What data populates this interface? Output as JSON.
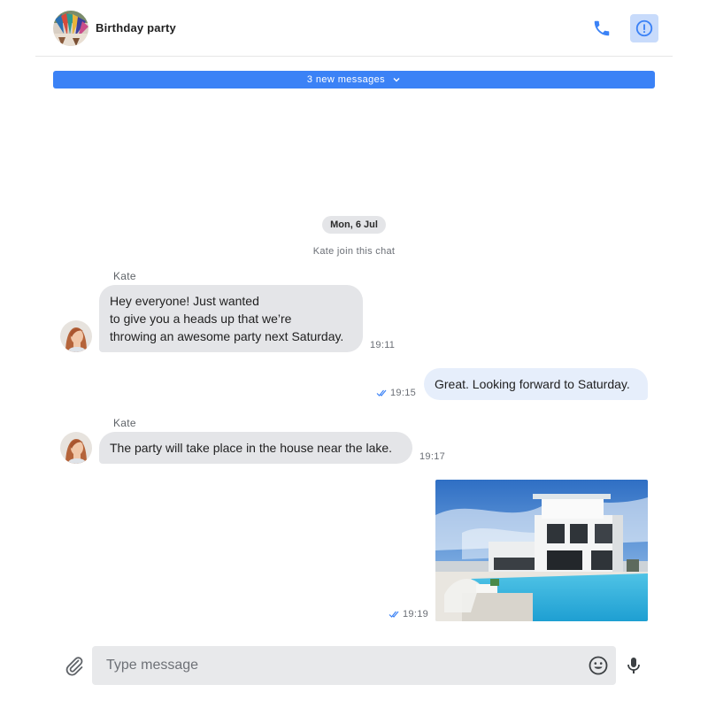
{
  "header": {
    "title": "Birthday party",
    "avatar_icon": "group-avatar-icon",
    "call_icon": "phone-icon",
    "info_icon": "info-icon",
    "accent_color": "#3b82f6"
  },
  "banner": {
    "label": "3 new messages",
    "icon": "chevron-down-icon"
  },
  "conversation": {
    "date_label": "Mon, 6 Jul",
    "system_message": "Kate join this chat",
    "messages": [
      {
        "sender": "Kate",
        "direction": "incoming",
        "lines": [
          "Hey everyone! Just wanted",
          "to give you a heads up that we’re",
          "throwing an awesome party next Saturday."
        ],
        "time": "19:11"
      },
      {
        "direction": "outgoing",
        "text": "Great. Looking forward to Saturday.",
        "time": "19:15",
        "status_icon": "double-check-icon"
      },
      {
        "sender": "Kate",
        "direction": "incoming",
        "text": "The party will take place in the house near the lake.",
        "time": "19:17"
      },
      {
        "direction": "outgoing",
        "type": "image",
        "image_subject": "modern white villa with swimming pool",
        "time": "19:19",
        "status_icon": "double-check-icon"
      }
    ]
  },
  "composer": {
    "placeholder": "Type message",
    "value": "",
    "attach_icon": "paperclip-icon",
    "emoji_icon": "emoji-icon",
    "mic_icon": "microphone-icon"
  }
}
